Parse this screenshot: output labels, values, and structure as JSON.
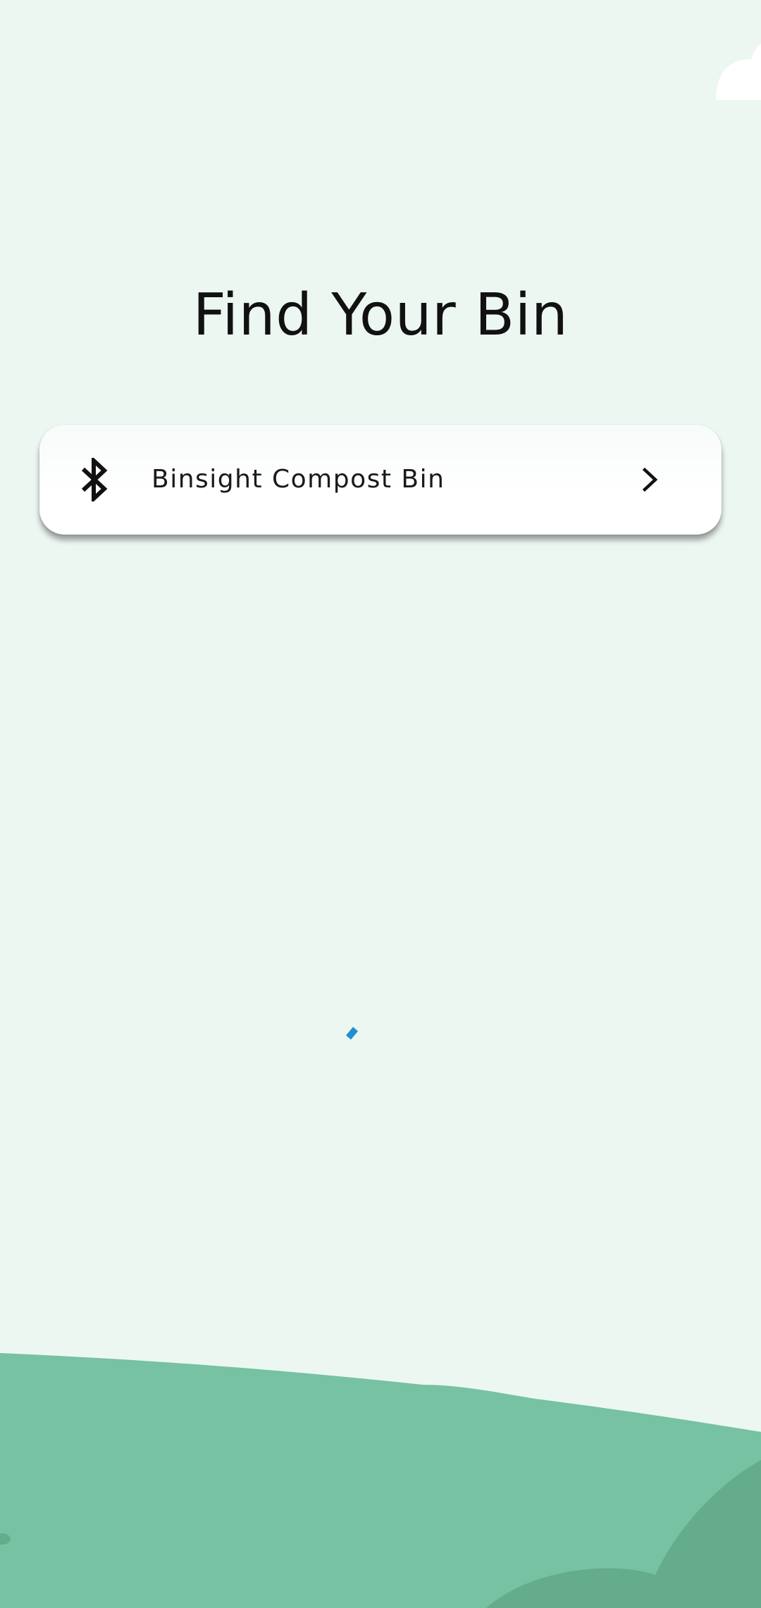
{
  "screen": {
    "title": "Find Your Bin",
    "background_color": "#edf7f2"
  },
  "device_list": {
    "items": [
      {
        "name": "Binsight Compost Bin",
        "icon": "bluetooth-icon",
        "action_icon": "chevron-right-icon"
      }
    ]
  },
  "scan_indicator": {
    "icon": "loading-spinner-icon",
    "color": "#1e8fd0"
  },
  "decor": {
    "hill_color": "#76c2a3",
    "hill_dark_color": "#64ac8c",
    "cloud_color": "#ffffff"
  }
}
